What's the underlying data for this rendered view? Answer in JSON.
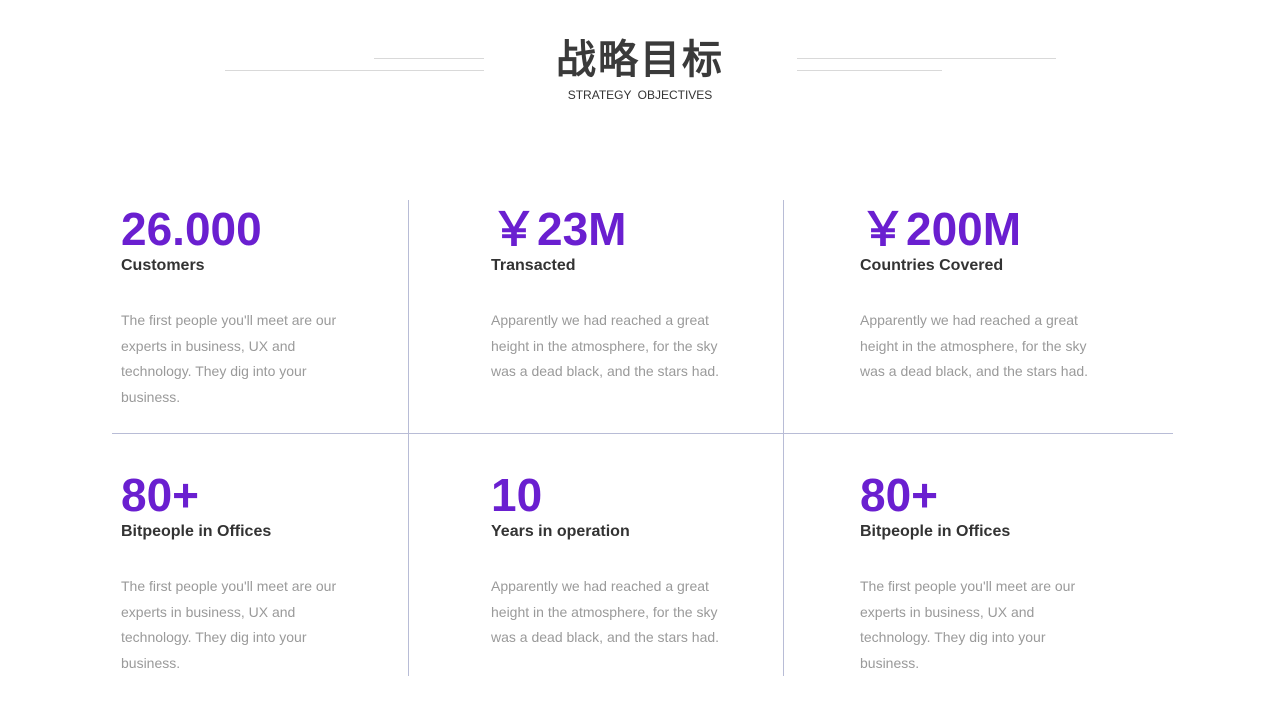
{
  "header": {
    "title": "战略目标",
    "subtitle": "STRATEGY  OBJECTIVES"
  },
  "stats": [
    {
      "value": "26.000",
      "label": "Customers",
      "description": "The first people you'll meet are our experts in business, UX  and technology. They dig into your business."
    },
    {
      "value": "￥23M",
      "label": "Transacted",
      "description": "Apparently we  had reached a great height in the atmosphere, for the sky was  a dead black, and the stars had."
    },
    {
      "value": "￥200M",
      "label": "Countries Covered",
      "description": "Apparently we  had reached a great height in the atmosphere, for the sky was  a dead black, and the stars had."
    },
    {
      "value": "80+",
      "label": "Bitpeople in Offices",
      "description": "The first people you'll meet are our experts in business, UX  and technology. They dig into your business."
    },
    {
      "value": "10",
      "label": "Years in operation",
      "description": "Apparently we  had reached a great height in the atmosphere, for the sky was  a dead black, and the stars had."
    },
    {
      "value": "80+",
      "label": "Bitpeople in Offices",
      "description": "The first people you'll meet are our experts in business, UX  and technology. They dig into your business."
    }
  ],
  "colors": {
    "accent": "#6a1fd0",
    "heading": "#333333",
    "body": "#9a9a9a",
    "divider": "#b8bcd6"
  }
}
